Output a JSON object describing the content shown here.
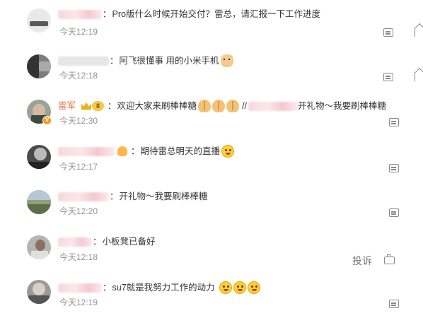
{
  "comments": [
    {
      "text": "Pro版什么时候开始交付？雷总，请汇报一下工作进度",
      "time": "今天12:19",
      "action_icon": "comment-icon"
    },
    {
      "text": "阿飞很懂事 用的小米手机",
      "time": "今天12:18",
      "action_icon": "comment-icon"
    },
    {
      "name": "雷军",
      "level": "II",
      "text_a": "欢迎大家来刷棒棒糖",
      "text_b": "//",
      "text_c": "开礼物～我要刷棒棒糖",
      "time": "今天12:30",
      "action_icon": "comment-icon"
    },
    {
      "text": "期待雷总明天的直播",
      "time": "今天12:17",
      "action_icon": "comment-icon"
    },
    {
      "text": "开礼物～我要刷棒棒糖",
      "time": "今天12:20",
      "action_icon": "comment-icon"
    },
    {
      "text": "小板凳已备好",
      "time": "今天12:18",
      "report_label": "投诉",
      "action_icon": "report-icon"
    },
    {
      "text": "su7就是我努力工作的动力",
      "time": "今天12:19",
      "action_icon": "comment-icon"
    }
  ],
  "colors": {
    "name_accent": "#eb7350",
    "time_gray": "#939393",
    "text": "#333333"
  }
}
